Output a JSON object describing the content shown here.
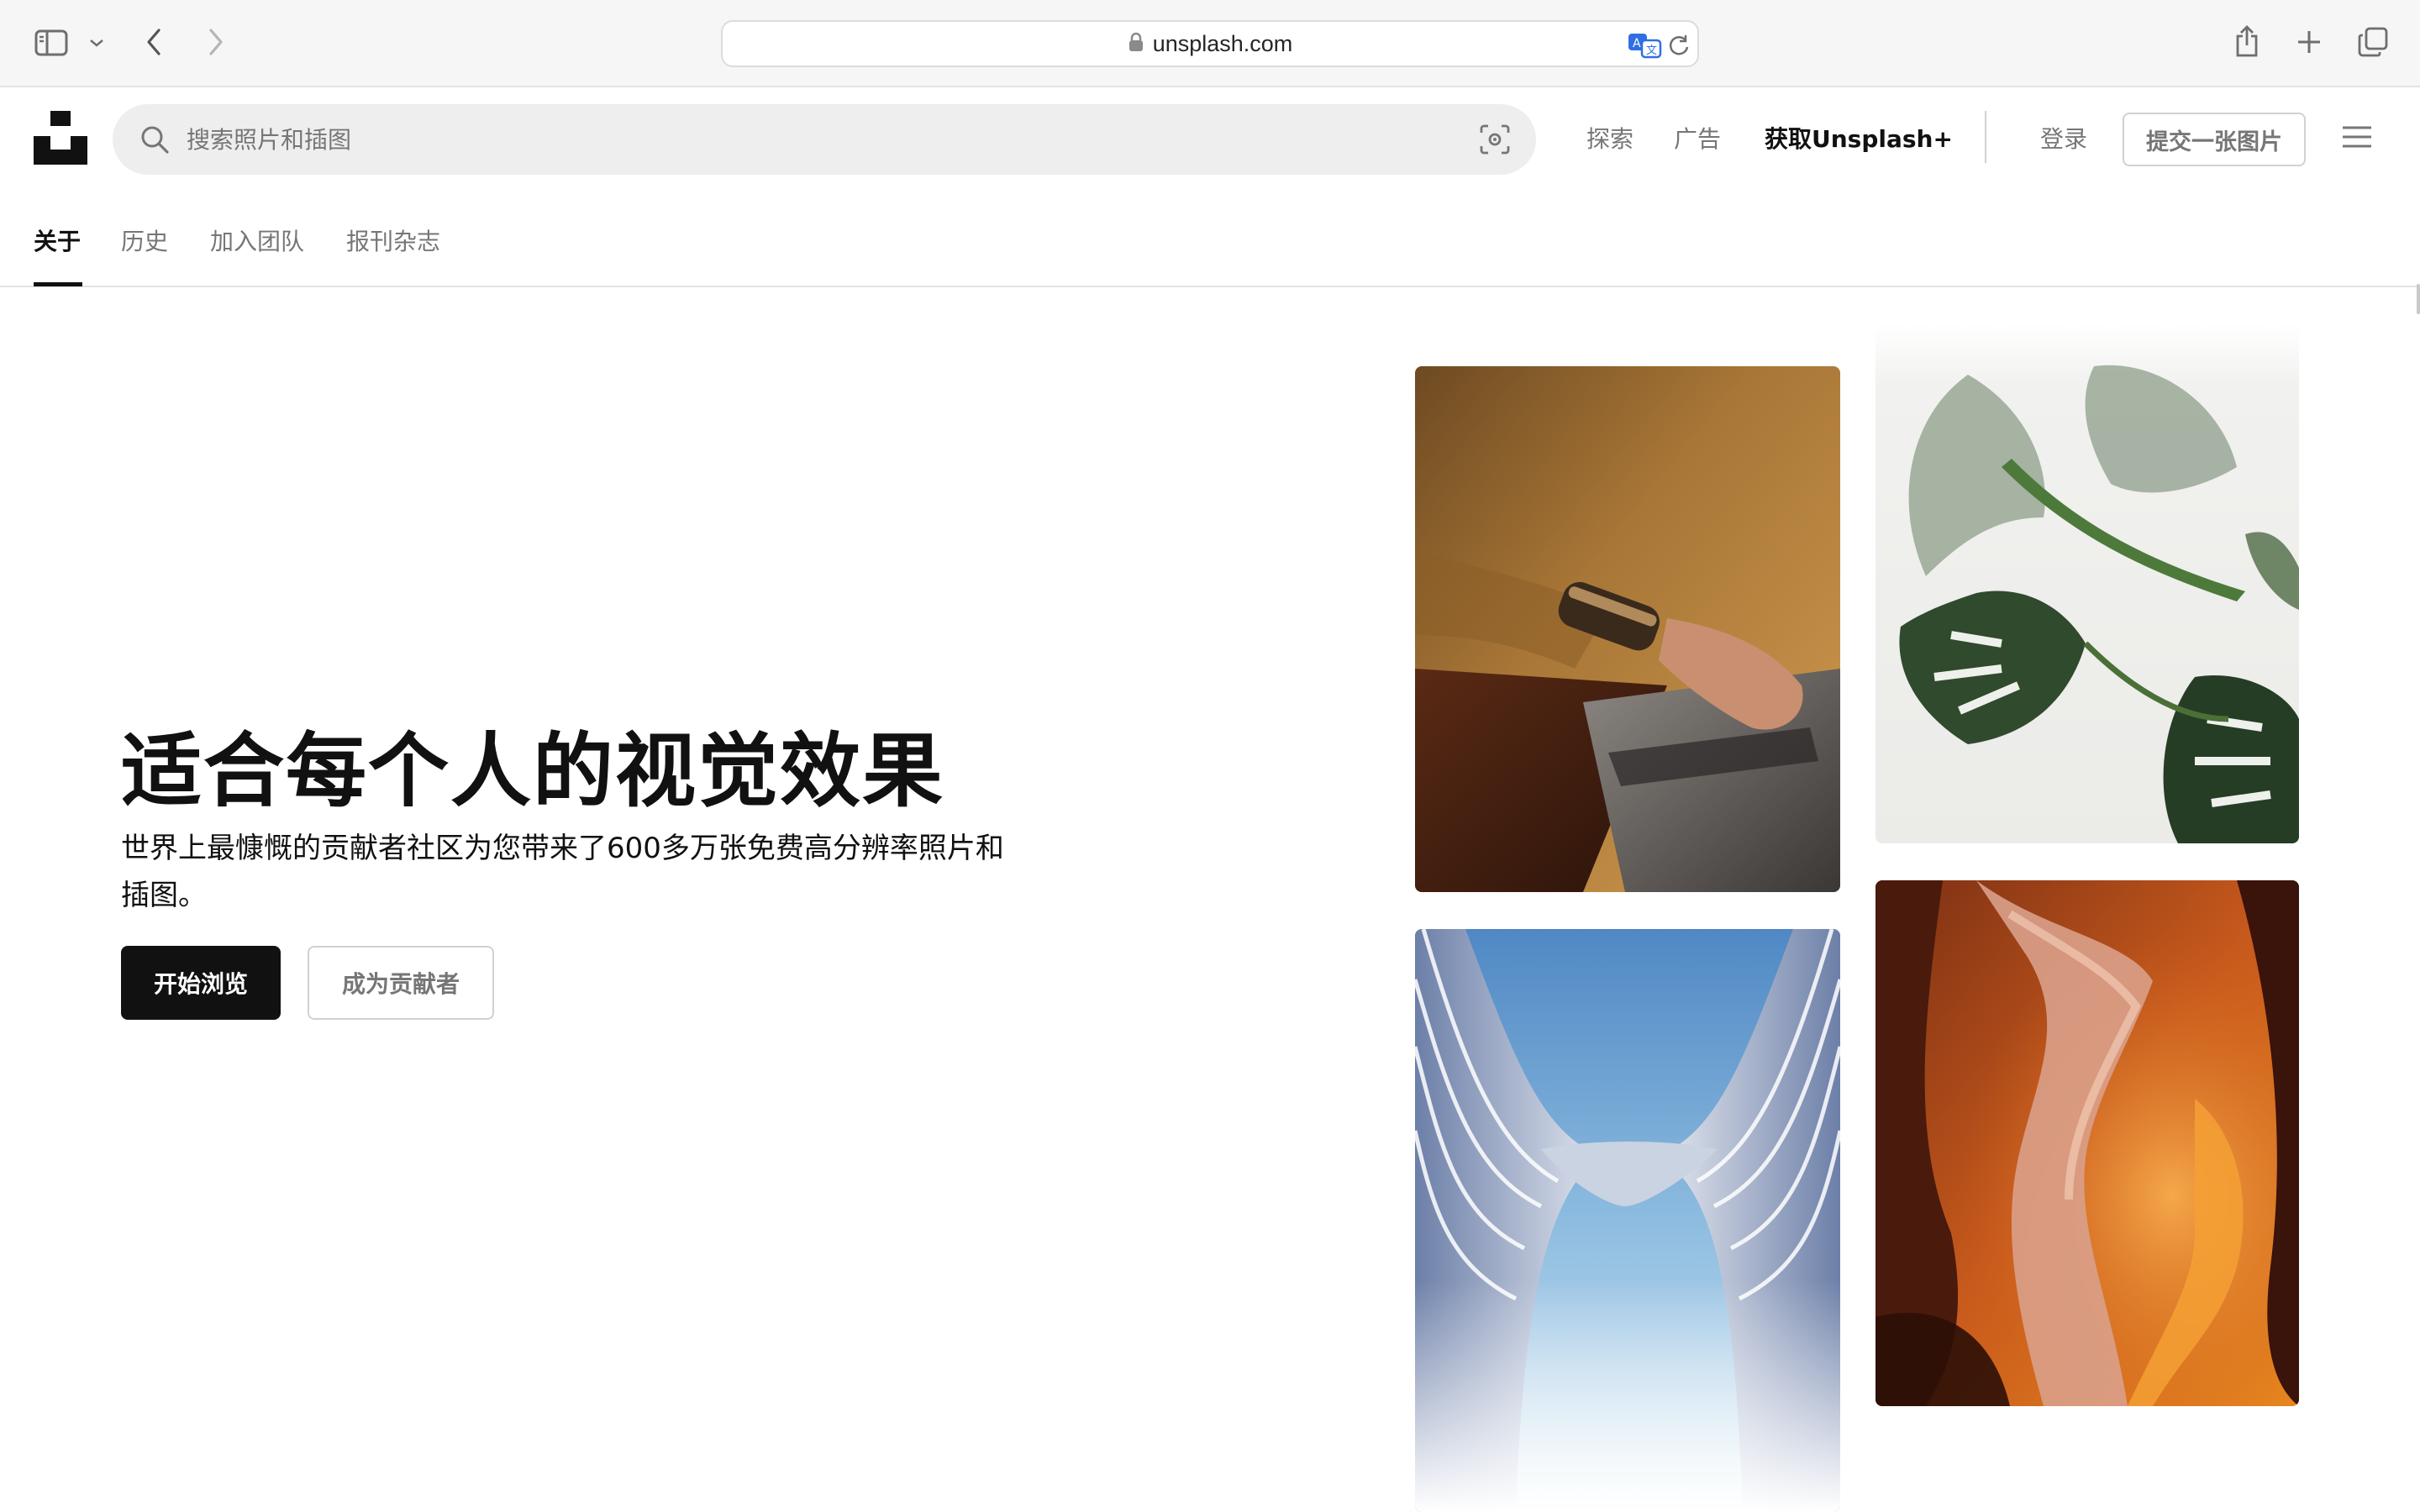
{
  "browser": {
    "url": "unsplash.com",
    "icons": [
      "sidebar-toggle-icon",
      "chevron-down-icon",
      "back-arrow-icon",
      "forward-arrow-icon",
      "lock-icon",
      "translate-icon",
      "reload-icon",
      "share-icon",
      "new-tab-plus-icon",
      "tab-overview-icon"
    ]
  },
  "header": {
    "logo": "unsplash-logo-icon",
    "search": {
      "placeholder": "搜索照片和插图"
    },
    "nav": {
      "explore": "探索",
      "advertise": "广告",
      "get_plus": "获取Unsplash+",
      "login": "登录",
      "submit": "提交一张图片"
    },
    "menu_icon": "hamburger-menu-icon"
  },
  "subnav": {
    "tabs": [
      {
        "label": "关于",
        "active": true
      },
      {
        "label": "历史",
        "active": false
      },
      {
        "label": "加入团队",
        "active": false
      },
      {
        "label": "报刊杂志",
        "active": false
      }
    ]
  },
  "hero": {
    "title": "适合每个人的视觉效果",
    "description": "世界上最慷慨的贡献者社区为您带来了600多万张免费高分辨率照片和插图。",
    "primary_button": "开始浏览",
    "secondary_button": "成为贡献者"
  },
  "gallery": {
    "photos": [
      "photo-person-laptop",
      "photo-monstera-plant",
      "photo-curved-building",
      "photo-canyon"
    ]
  },
  "colors": {
    "primary_button_bg": "#111111",
    "muted_text": "#767676",
    "search_bg": "#eeeeee"
  }
}
